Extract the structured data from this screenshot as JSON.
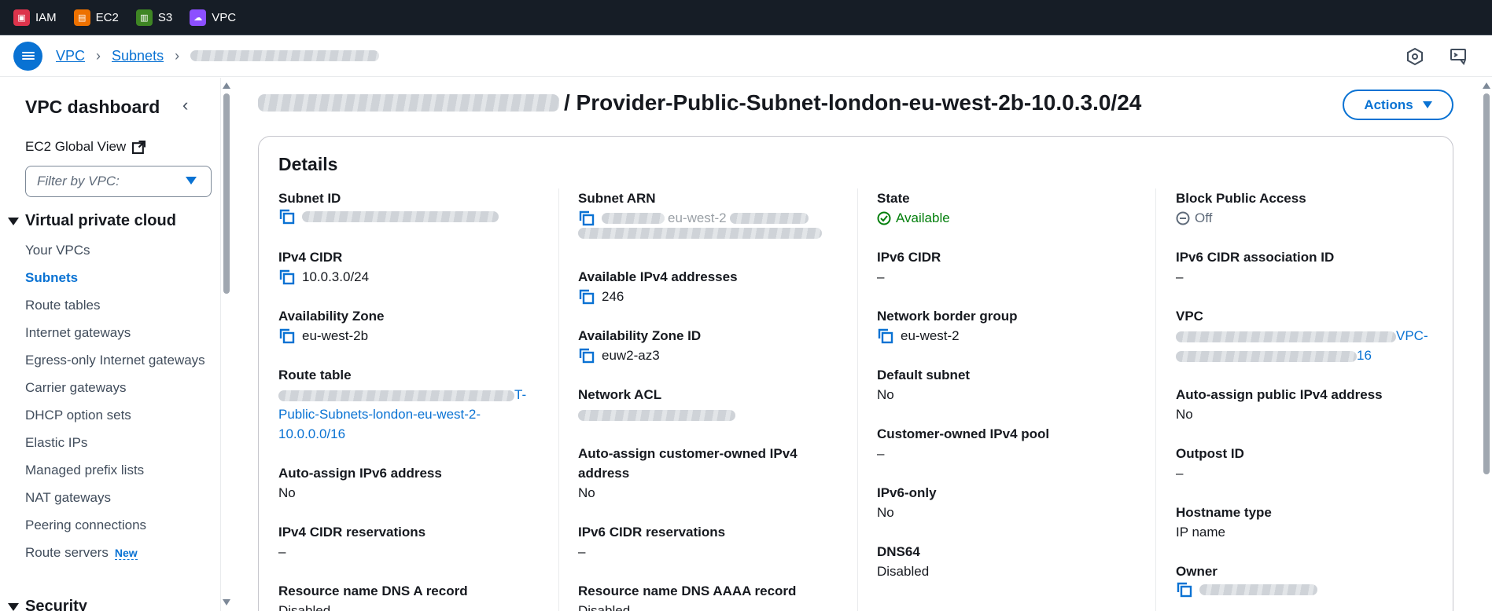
{
  "topbar": {
    "services": [
      {
        "label": "IAM",
        "color": "#dd344c"
      },
      {
        "label": "EC2",
        "color": "#ed7100"
      },
      {
        "label": "S3",
        "color": "#3f8624"
      },
      {
        "label": "VPC",
        "color": "#8c4fff"
      }
    ]
  },
  "breadcrumb": {
    "items": [
      "VPC",
      "Subnets"
    ]
  },
  "sidebar": {
    "title": "VPC dashboard",
    "ec2_global_view": "EC2 Global View",
    "filter_placeholder": "Filter by VPC:",
    "section_title": "Virtual private cloud",
    "items": [
      {
        "label": "Your VPCs"
      },
      {
        "label": "Subnets"
      },
      {
        "label": "Route tables"
      },
      {
        "label": "Internet gateways"
      },
      {
        "label": "Egress-only Internet gateways"
      },
      {
        "label": "Carrier gateways"
      },
      {
        "label": "DHCP option sets"
      },
      {
        "label": "Elastic IPs"
      },
      {
        "label": "Managed prefix lists"
      },
      {
        "label": "NAT gateways"
      },
      {
        "label": "Peering connections"
      },
      {
        "label": "Route servers"
      }
    ],
    "new_badge": "New",
    "section2_title": "Security"
  },
  "page": {
    "title_suffix": "/ Provider-Public-Subnet-london-eu-west-2b-10.0.3.0/24",
    "actions_label": "Actions"
  },
  "details": {
    "title": "Details",
    "col1": {
      "subnet_id_label": "Subnet ID",
      "ipv4_cidr_label": "IPv4 CIDR",
      "ipv4_cidr_value": "10.0.3.0/24",
      "az_label": "Availability Zone",
      "az_value": "eu-west-2b",
      "route_table_label": "Route table",
      "route_table_value_l1": "T-",
      "route_table_value_l2": "Public-Subnets-london-eu-west-2-",
      "route_table_value_l3": "10.0.0.0/16",
      "auto_ipv6_label": "Auto-assign IPv6 address",
      "auto_ipv6_value": "No",
      "ipv4_res_label": "IPv4 CIDR reservations",
      "ipv4_res_value": "–",
      "dns_a_label": "Resource name DNS A record",
      "dns_a_value": "Disabled"
    },
    "col2": {
      "arn_label": "Subnet ARN",
      "arn_value_part": "eu-west-2",
      "avail_ipv4_label": "Available IPv4 addresses",
      "avail_ipv4_value": "246",
      "az_id_label": "Availability Zone ID",
      "az_id_value": "euw2-az3",
      "nacl_label": "Network ACL",
      "auto_coip_label_l1": "Auto-assign customer-owned IPv4",
      "auto_coip_label_l2": "address",
      "auto_coip_value": "No",
      "ipv6_res_label": "IPv6 CIDR reservations",
      "ipv6_res_value": "–",
      "dns_aaaa_label": "Resource name DNS AAAA record",
      "dns_aaaa_value": "Disabled"
    },
    "col3": {
      "state_label": "State",
      "state_value": "Available",
      "ipv6_cidr_label": "IPv6 CIDR",
      "ipv6_cidr_value": "–",
      "nbg_label": "Network border group",
      "nbg_value": "eu-west-2",
      "default_label": "Default subnet",
      "default_value": "No",
      "coip_pool_label": "Customer-owned IPv4 pool",
      "coip_pool_value": "–",
      "ipv6_only_label": "IPv6-only",
      "ipv6_only_value": "No",
      "dns64_label": "DNS64",
      "dns64_value": "Disabled"
    },
    "col4": {
      "bpa_label": "Block Public Access",
      "bpa_value": "Off",
      "ipv6_assoc_label": "IPv6 CIDR association ID",
      "ipv6_assoc_value": "–",
      "vpc_label": "VPC",
      "vpc_value_l1": "VPC-",
      "vpc_value_l2": "16",
      "auto_public_label": "Auto-assign public IPv4 address",
      "auto_public_value": "No",
      "outpost_label": "Outpost ID",
      "outpost_value": "–",
      "hostname_label": "Hostname type",
      "hostname_value": "IP name",
      "owner_label": "Owner"
    }
  },
  "colors": {
    "link": "#0972d3",
    "success": "#037f0c",
    "topbar_bg": "#161d26"
  }
}
